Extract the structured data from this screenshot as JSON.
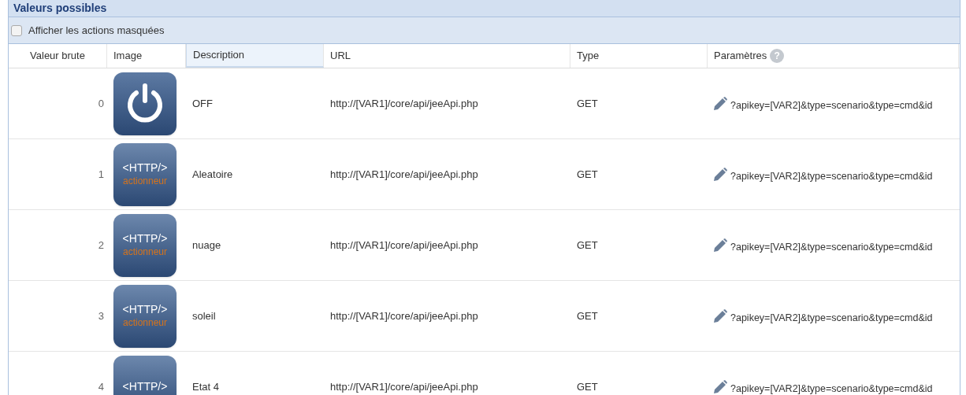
{
  "panel": {
    "title": "Valeurs possibles"
  },
  "show_hidden": {
    "label": "Afficher les actions masquées",
    "checked": false
  },
  "table": {
    "columns": [
      {
        "label": "Valeur brute",
        "selected": false
      },
      {
        "label": "Image",
        "selected": false
      },
      {
        "label": "Description",
        "selected": true
      },
      {
        "label": "URL",
        "selected": false
      },
      {
        "label": "Type",
        "selected": false
      },
      {
        "label": "Paramètres",
        "selected": false,
        "help": "?"
      }
    ],
    "rows": [
      {
        "value": "0",
        "image": {
          "kind": "power"
        },
        "description": "OFF",
        "url": "http://[VAR1]/core/api/jeeApi.php",
        "type": "GET",
        "params": "?apikey=[VAR2]&type=scenario&type=cmd&id"
      },
      {
        "value": "1",
        "image": {
          "kind": "http",
          "tag": "<HTTP/>",
          "caption": "actionneur"
        },
        "description": "Aleatoire",
        "url": "http://[VAR1]/core/api/jeeApi.php",
        "type": "GET",
        "params": "?apikey=[VAR2]&type=scenario&type=cmd&id"
      },
      {
        "value": "2",
        "image": {
          "kind": "http",
          "tag": "<HTTP/>",
          "caption": "actionneur"
        },
        "description": "nuage",
        "url": "http://[VAR1]/core/api/jeeApi.php",
        "type": "GET",
        "params": "?apikey=[VAR2]&type=scenario&type=cmd&id"
      },
      {
        "value": "3",
        "image": {
          "kind": "http",
          "tag": "<HTTP/>",
          "caption": "actionneur"
        },
        "description": "soleil",
        "url": "http://[VAR1]/core/api/jeeApi.php",
        "type": "GET",
        "params": "?apikey=[VAR2]&type=scenario&type=cmd&id"
      },
      {
        "value": "4",
        "image": {
          "kind": "http",
          "tag": "<HTTP/>"
        },
        "description": "Etat 4",
        "url": "http://[VAR1]/core/api/jeeApi.php",
        "type": "GET",
        "params": "?apikey=[VAR2]&type=scenario&type=cmd&id"
      }
    ]
  }
}
